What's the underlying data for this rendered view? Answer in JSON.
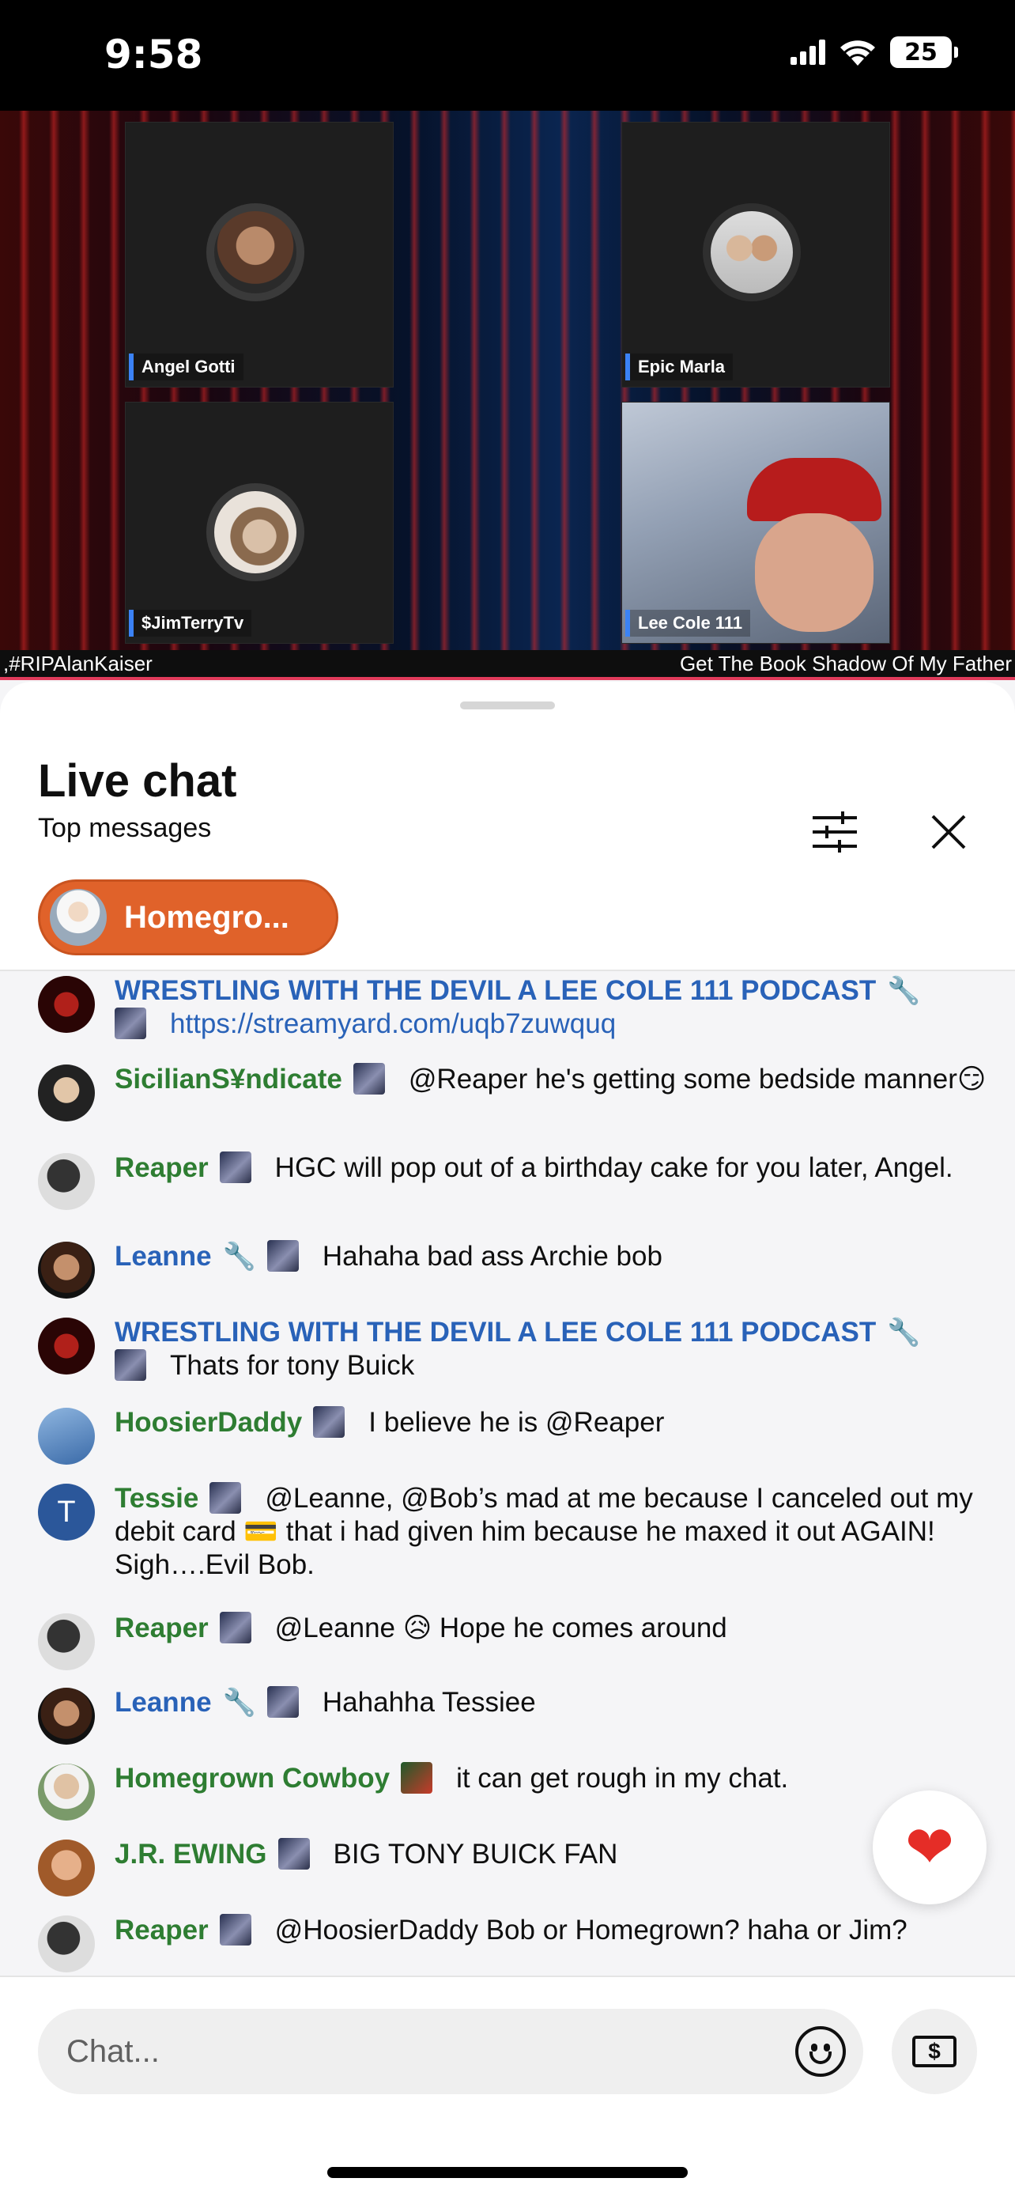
{
  "status": {
    "time": "9:58",
    "battery": "25"
  },
  "stream": {
    "participants": [
      {
        "name": "Angel Gotti"
      },
      {
        "name": "Epic Marla"
      },
      {
        "name": "$JimTerryTv"
      },
      {
        "name": "Lee Cole 111"
      }
    ],
    "ticker_left": ",#RIPAlanKaiser",
    "ticker_right": "Get The Book Shadow Of My Father"
  },
  "chat": {
    "title": "Live chat",
    "subtitle": "Top messages",
    "pinned_pill": "Homegro...",
    "input_placeholder": "Chat...",
    "messages": [
      {
        "author": "WRESTLING WITH THE DEVIL A LEE COLE 111 PODCAST",
        "text": "https://streamyard.com/uqb7zuwquq"
      },
      {
        "author": "SicilianS¥ndicate",
        "text": "@Reaper he's getting some bedside manner😏"
      },
      {
        "author": "Reaper",
        "text": "HGC will pop out of a birthday cake for you later, Angel."
      },
      {
        "author": "Leanne",
        "text": "Hahaha bad ass Archie bob"
      },
      {
        "author": "WRESTLING WITH THE DEVIL A LEE COLE 111 PODCAST",
        "text": "Thats for tony Buick"
      },
      {
        "author": "HoosierDaddy",
        "text": "I believe he is @Reaper"
      },
      {
        "author": "Tessie",
        "text": "@Leanne, @Bob’s mad at me because I canceled out my debit card 💳 that i had given him because he maxed it out AGAIN! Sigh….Evil Bob."
      },
      {
        "author": "Reaper",
        "text": "@Leanne 😥 Hope he comes around"
      },
      {
        "author": "Leanne",
        "text": "Hahahha Tessiee"
      },
      {
        "author": "Homegrown Cowboy",
        "text": "it can get rough in my chat."
      },
      {
        "author": "J.R. EWING",
        "text": "BIG TONY BUICK FAN"
      },
      {
        "author": "Reaper",
        "text": "@HoosierDaddy Bob or Homegrown? haha or Jim?"
      }
    ]
  },
  "avatar_initial": "T",
  "colors": {
    "moderator_blue": "#2962b8",
    "member_green": "#2e7d32",
    "pill_orange": "#e0622a",
    "heart_red": "#e52d27"
  },
  "icons": [
    "signal-icon",
    "wifi-icon",
    "battery-icon",
    "filter-icon",
    "close-icon",
    "wrench-icon",
    "emoji-icon",
    "super-chat-icon",
    "heart-icon"
  ]
}
